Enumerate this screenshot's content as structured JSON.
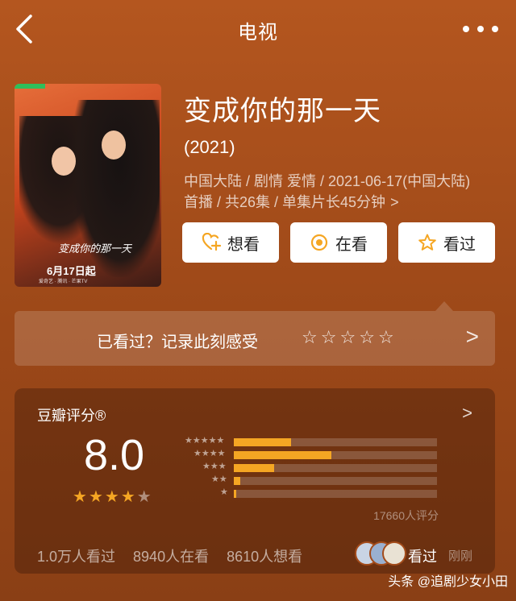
{
  "header": {
    "title": "电视"
  },
  "poster": {
    "title_text": "变成你的那一天",
    "date_text": "6月17日起",
    "platform_logos": "爱奇艺 · 腾讯 · 芒果TV"
  },
  "show": {
    "title": "变成你的那一天",
    "year": "(2021)",
    "meta": "中国大陆 / 剧情 爱情 / 2021-06-17(中国大陆)首播 / 共26集 / 单集片长45分钟",
    "meta_chevron": ">"
  },
  "actions": {
    "want": "想看",
    "watching": "在看",
    "watched": "看过"
  },
  "rate_prompt": {
    "text": "已看过？记录此刻感受",
    "stars": [
      "☆",
      "☆",
      "☆",
      "☆",
      "☆"
    ],
    "arrow": ">"
  },
  "rating": {
    "label": "豆瓣评分®",
    "arrow": ">",
    "score": "8.0",
    "stars": 4,
    "star_glyph_on": "★",
    "star_glyph_off": "★",
    "distribution": [
      {
        "label": "★★★★★",
        "pct": 28
      },
      {
        "label": "★★★★",
        "pct": 48
      },
      {
        "label": "★★★",
        "pct": 20
      },
      {
        "label": "★★",
        "pct": 3
      },
      {
        "label": "★",
        "pct": 1
      }
    ],
    "count": "17660人评分"
  },
  "stats": {
    "watched": "1.0万人看过",
    "watching": "8940人在看",
    "want": "8610人想看"
  },
  "friends": {
    "action": "看过",
    "time": "刚刚"
  },
  "watermark": "头条 @追剧少女小田",
  "colors": {
    "accent": "#f5a623",
    "background": "#a84f1b"
  }
}
